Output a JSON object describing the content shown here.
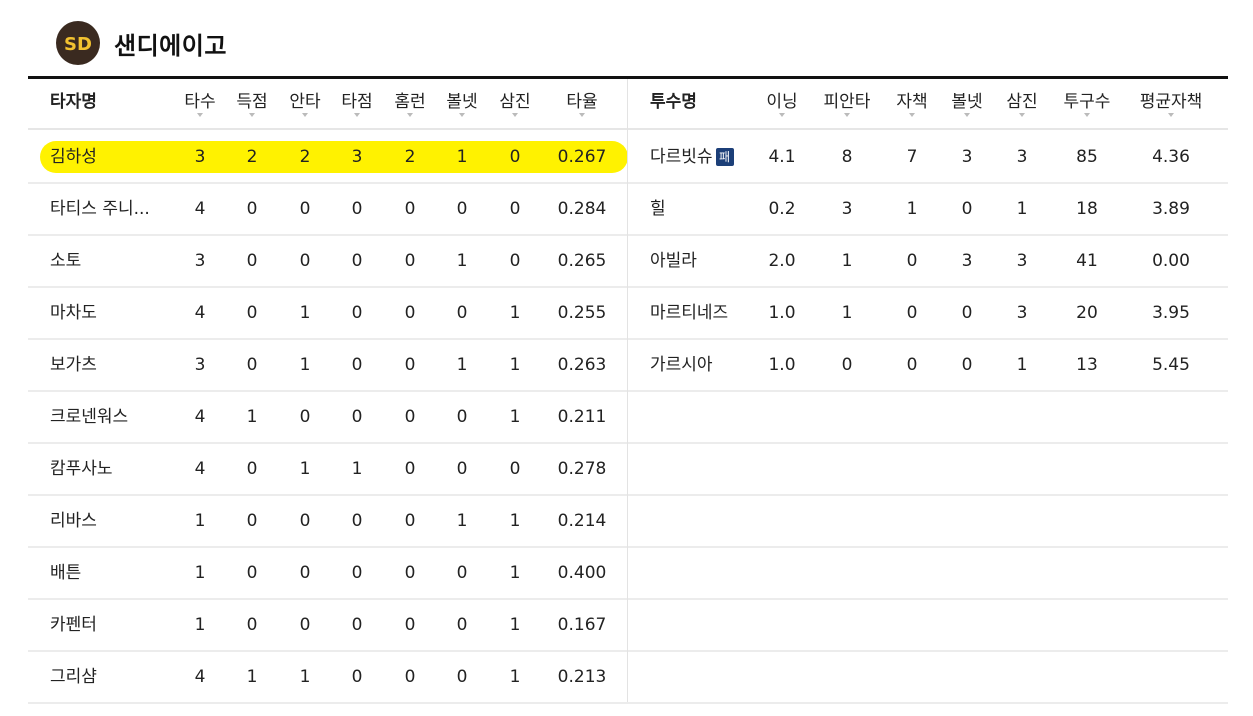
{
  "team": {
    "name": "샌디에이고"
  },
  "batting": {
    "headers": [
      "타자명",
      "타수",
      "득점",
      "안타",
      "타점",
      "홈런",
      "볼넷",
      "삼진",
      "타율"
    ],
    "rows": [
      [
        "김하성",
        "3",
        "2",
        "2",
        "3",
        "2",
        "1",
        "0",
        "0.267"
      ],
      [
        "타티스 주니...",
        "4",
        "0",
        "0",
        "0",
        "0",
        "0",
        "0",
        "0.284"
      ],
      [
        "소토",
        "3",
        "0",
        "0",
        "0",
        "0",
        "1",
        "0",
        "0.265"
      ],
      [
        "마차도",
        "4",
        "0",
        "1",
        "0",
        "0",
        "0",
        "1",
        "0.255"
      ],
      [
        "보가츠",
        "3",
        "0",
        "1",
        "0",
        "0",
        "1",
        "1",
        "0.263"
      ],
      [
        "크로넨워스",
        "4",
        "1",
        "0",
        "0",
        "0",
        "0",
        "1",
        "0.211"
      ],
      [
        "캄푸사노",
        "4",
        "0",
        "1",
        "1",
        "0",
        "0",
        "0",
        "0.278"
      ],
      [
        "리바스",
        "1",
        "0",
        "0",
        "0",
        "0",
        "1",
        "1",
        "0.214"
      ],
      [
        "배튼",
        "1",
        "0",
        "0",
        "0",
        "0",
        "0",
        "1",
        "0.400"
      ],
      [
        "카펜터",
        "1",
        "0",
        "0",
        "0",
        "0",
        "0",
        "1",
        "0.167"
      ],
      [
        "그리샴",
        "4",
        "1",
        "1",
        "0",
        "0",
        "0",
        "1",
        "0.213"
      ]
    ],
    "highlighted_player": "김하성",
    "highlight_color": "#fff200"
  },
  "pitching": {
    "headers": [
      "투수명",
      "이닝",
      "피안타",
      "자책",
      "볼넷",
      "삼진",
      "투구수",
      "평균자책"
    ],
    "rows": [
      [
        "다르빗슈",
        "4.1",
        "8",
        "7",
        "3",
        "3",
        "85",
        "4.36"
      ],
      [
        "힐",
        "0.2",
        "3",
        "1",
        "0",
        "1",
        "18",
        "3.89"
      ],
      [
        "아빌라",
        "2.0",
        "1",
        "0",
        "3",
        "3",
        "41",
        "0.00"
      ],
      [
        "마르티네즈",
        "1.0",
        "1",
        "0",
        "0",
        "3",
        "20",
        "3.95"
      ],
      [
        "가르시아",
        "1.0",
        "0",
        "0",
        "0",
        "1",
        "13",
        "5.45"
      ]
    ],
    "decision_badge": {
      "player": "다르빗슈",
      "label": "패",
      "color": "#1c3f78"
    }
  }
}
